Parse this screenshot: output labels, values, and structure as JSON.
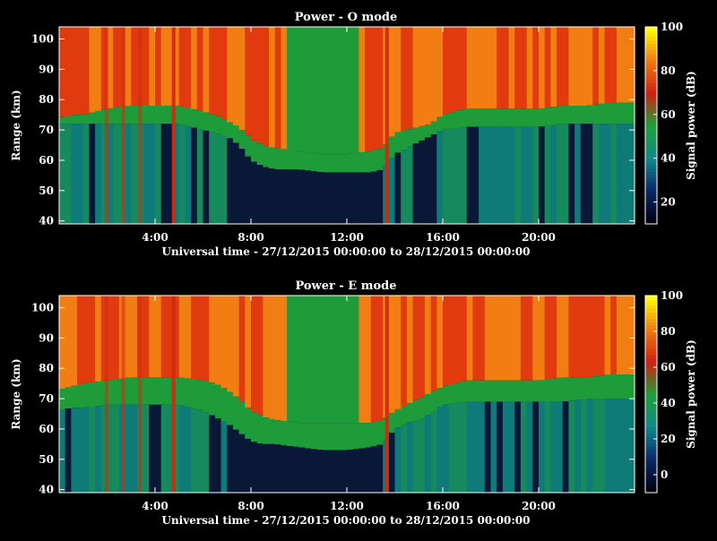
{
  "chart_data": [
    {
      "type": "heatmap",
      "title": "Power - O mode",
      "xlabel": "Universal time - 27/12/2015 00:00:00 to 28/12/2015 00:00:00",
      "ylabel": "Range (km)",
      "colorbar_label": "Signal power (dB)",
      "x_range_hours": [
        0,
        24
      ],
      "ylim": [
        39,
        104
      ],
      "x_ticks": [
        "4:00",
        "8:00",
        "12:00",
        "16:00",
        "20:00"
      ],
      "x_tick_hours": [
        4,
        8,
        12,
        16,
        20
      ],
      "y_ticks": [
        40,
        50,
        60,
        70,
        80,
        90,
        100
      ],
      "colorbar_range": [
        10,
        100
      ],
      "colorbar_ticks": [
        20,
        40,
        60,
        80,
        100
      ],
      "profile": {
        "hours": [
          0,
          0.5,
          1,
          2,
          3,
          4,
          5,
          6,
          6.5,
          7,
          7.5,
          8,
          8.5,
          9,
          10,
          11,
          12,
          13,
          13.5,
          14,
          14.5,
          15,
          15.5,
          16,
          17,
          18,
          19,
          20,
          21,
          22,
          23,
          24
        ],
        "boundary_km": [
          74,
          75,
          75,
          77,
          78,
          78,
          78,
          76,
          75,
          73,
          71,
          67,
          65,
          64,
          63,
          62,
          62,
          63,
          64,
          69,
          70,
          71,
          72,
          75,
          77,
          77,
          77,
          77,
          78,
          78,
          79,
          79
        ],
        "lower_top_km": [
          72,
          72,
          72,
          72,
          72,
          72,
          72,
          70,
          69,
          68,
          65,
          60,
          58,
          57,
          57,
          56,
          56,
          56,
          57,
          62,
          64,
          66,
          68,
          70,
          71,
          71,
          71,
          71,
          72,
          72,
          72,
          72
        ]
      },
      "daytime_notch_hours": [
        9.5,
        12.5
      ],
      "colors": {
        "background": "#000000",
        "upper": "#e03a0e",
        "upper_hot": "#f27d12",
        "band": "#1f9c3a",
        "lower": "#0e7b78",
        "lower_dark": "#0a1838",
        "accent_line": "#cf2a10",
        "highlight": "#ffee00"
      }
    },
    {
      "type": "heatmap",
      "title": "Power - E mode",
      "xlabel": "Universal time - 27/12/2015 00:00:00 to 28/12/2015 00:00:00",
      "ylabel": "Range (km)",
      "colorbar_label": "Signal power (dB)",
      "x_range_hours": [
        0,
        24
      ],
      "ylim": [
        39,
        104
      ],
      "x_ticks": [
        "4:00",
        "8:00",
        "12:00",
        "16:00",
        "20:00"
      ],
      "x_tick_hours": [
        4,
        8,
        12,
        16,
        20
      ],
      "y_ticks": [
        40,
        50,
        60,
        70,
        80,
        90,
        100
      ],
      "colorbar_range": [
        -10,
        100
      ],
      "colorbar_ticks": [
        0,
        20,
        40,
        60,
        80,
        100
      ],
      "profile": {
        "hours": [
          0,
          0.5,
          1,
          2,
          3,
          4,
          5,
          6,
          6.5,
          7,
          7.5,
          8,
          8.5,
          9,
          10,
          11,
          12,
          13,
          13.5,
          14,
          14.5,
          15,
          15.5,
          16,
          17,
          18,
          19,
          20,
          21,
          22,
          23,
          24
        ],
        "boundary_km": [
          73,
          74,
          75,
          76,
          77,
          77,
          77,
          76,
          75,
          73,
          70,
          66,
          64,
          63,
          62,
          62,
          62,
          62,
          63,
          66,
          68,
          70,
          72,
          74,
          76,
          76,
          76,
          76,
          77,
          77,
          78,
          78
        ],
        "lower_top_km": [
          66,
          67,
          67,
          68,
          68,
          68,
          68,
          66,
          64,
          62,
          59,
          56,
          55,
          55,
          54,
          53,
          53,
          54,
          55,
          60,
          62,
          63,
          65,
          68,
          69,
          69,
          69,
          69,
          69,
          70,
          70,
          70
        ]
      },
      "daytime_notch_hours": [
        9.5,
        12.5
      ],
      "colors": {
        "background": "#000000",
        "upper": "#e03a0e",
        "upper_hot": "#f27d12",
        "band": "#1f9c3a",
        "lower": "#0e7b78",
        "lower_dark": "#0a1838",
        "accent_line": "#cf2a10",
        "highlight": "#ffee00"
      }
    }
  ]
}
